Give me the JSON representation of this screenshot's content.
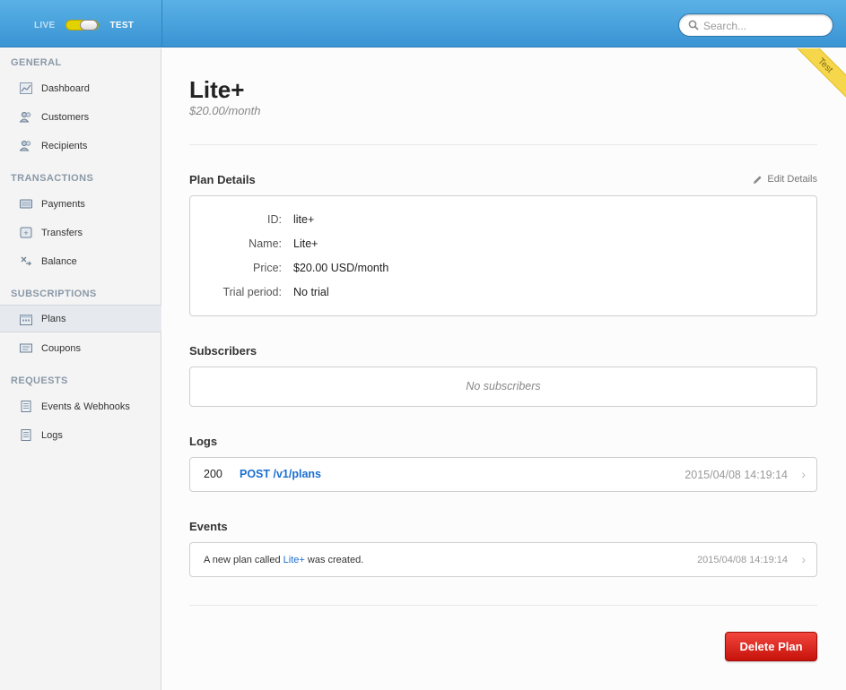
{
  "topbar": {
    "mode_live": "LIVE",
    "mode_test": "TEST",
    "search_placeholder": "Search..."
  },
  "sidebar": {
    "sections": [
      {
        "title": "GENERAL",
        "items": [
          "Dashboard",
          "Customers",
          "Recipients"
        ]
      },
      {
        "title": "TRANSACTIONS",
        "items": [
          "Payments",
          "Transfers",
          "Balance"
        ]
      },
      {
        "title": "SUBSCRIPTIONS",
        "items": [
          "Plans",
          "Coupons"
        ]
      },
      {
        "title": "REQUESTS",
        "items": [
          "Events & Webhooks",
          "Logs"
        ]
      }
    ],
    "active_item": "Plans"
  },
  "ribbon": "Test",
  "plan": {
    "name": "Lite+",
    "price_line": "$20.00/month"
  },
  "details": {
    "heading": "Plan Details",
    "edit_label": "Edit Details",
    "rows": [
      {
        "label": "ID:",
        "value": "lite+"
      },
      {
        "label": "Name:",
        "value": "Lite+"
      },
      {
        "label": "Price:",
        "value": "$20.00 USD/month"
      },
      {
        "label": "Trial period:",
        "value": "No trial"
      }
    ]
  },
  "subscribers": {
    "heading": "Subscribers",
    "empty": "No subscribers"
  },
  "logs": {
    "heading": "Logs",
    "entries": [
      {
        "status": "200",
        "request": "POST /v1/plans",
        "time": "2015/04/08 14:19:14"
      }
    ]
  },
  "events": {
    "heading": "Events",
    "entries": [
      {
        "prefix": "A new plan called ",
        "link": "Lite+",
        "suffix": " was created.",
        "time": "2015/04/08 14:19:14"
      }
    ]
  },
  "delete_label": "Delete Plan",
  "colors": {
    "topbar": "#3a94d3",
    "link": "#1b6fd2",
    "danger": "#d8201a",
    "ribbon": "#f6d64b"
  }
}
